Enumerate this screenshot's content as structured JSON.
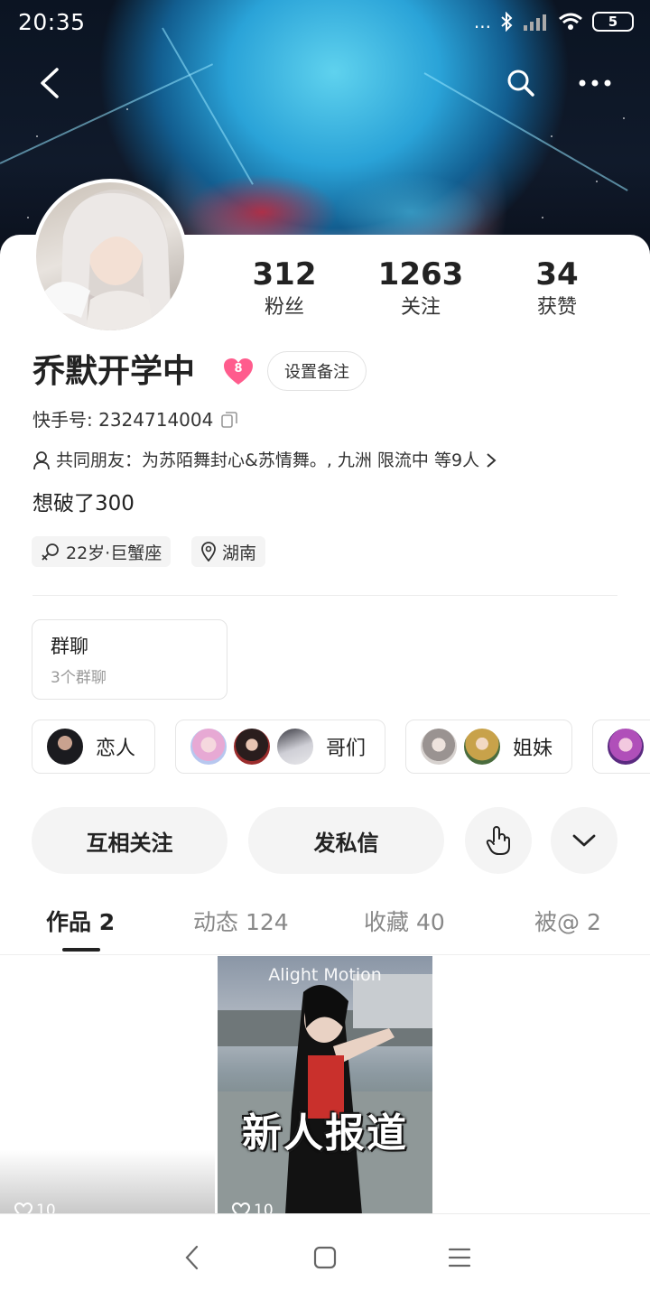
{
  "status_bar": {
    "time": "20:35",
    "signal_text": "...",
    "battery": "5"
  },
  "profile": {
    "stats": [
      {
        "value": "312",
        "label": "粉丝"
      },
      {
        "value": "1263",
        "label": "关注"
      },
      {
        "value": "34",
        "label": "获赞"
      }
    ],
    "name": "乔默开学中",
    "level": "8",
    "remark_button": "设置备注",
    "kuaishou_id": "快手号: 2324714004",
    "mutual_friends": "共同朋友：为苏陌舞封心&苏情舞。, 九洲  限流中 等9人",
    "bio": "想破了300",
    "tags": [
      "22岁·巨蟹座",
      "湖南"
    ]
  },
  "group": {
    "title": "群聊",
    "subtitle": "3个群聊"
  },
  "relation_chips": [
    "恋人",
    "哥们",
    "姐妹"
  ],
  "actions": {
    "mutual_follow": "互相关注",
    "message": "发私信"
  },
  "tabs": [
    "作品 2",
    "动态 124",
    "收藏 40",
    "被@ 2"
  ],
  "works": [
    {
      "likes": "10"
    },
    {
      "likes": "10",
      "watermark": "Alight Motion",
      "caption": "新人报道"
    }
  ],
  "icons": {
    "back": "back-arrow-icon",
    "search": "search-icon",
    "more": "more-icon",
    "copy": "copy-icon",
    "person": "person-icon",
    "chevron": "chevron-right-icon",
    "gender": "gender-icon",
    "location": "location-icon",
    "poke": "poke-hand-icon",
    "expand": "chevron-down-icon",
    "heart": "heart-icon"
  },
  "colors": {
    "level_badge": "#ff5c8d",
    "text_primary": "#222222",
    "text_secondary": "#999999"
  }
}
